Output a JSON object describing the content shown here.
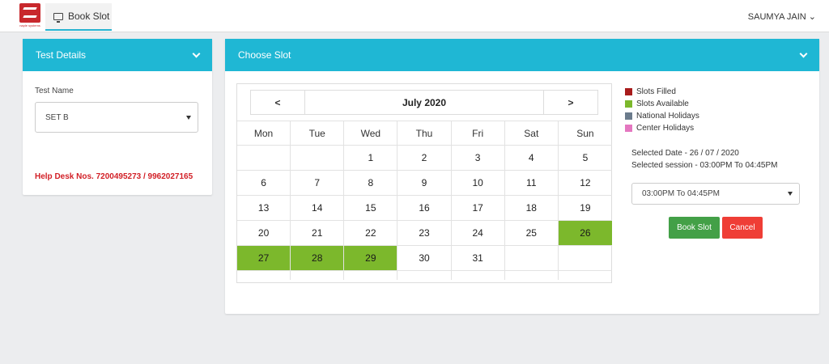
{
  "header": {
    "logo_caption": "naple systems",
    "tab_label": "Book Slot",
    "user_name": "SAUMYA JAIN ⌄"
  },
  "test_details": {
    "title": "Test Details",
    "test_name_label": "Test Name",
    "test_name_value": "SET B",
    "help_desk": "Help Desk Nos. 7200495273 / 9962027165"
  },
  "choose_slot": {
    "title": "Choose Slot",
    "prev": "<",
    "next": ">",
    "month_label": "July 2020",
    "weekdays": [
      "Mon",
      "Tue",
      "Wed",
      "Thu",
      "Fri",
      "Sat",
      "Sun"
    ],
    "weeks": [
      [
        "",
        "",
        "1",
        "2",
        "3",
        "4",
        "5"
      ],
      [
        "6",
        "7",
        "8",
        "9",
        "10",
        "11",
        "12"
      ],
      [
        "13",
        "14",
        "15",
        "16",
        "17",
        "18",
        "19"
      ],
      [
        "20",
        "21",
        "22",
        "23",
        "24",
        "25",
        "26"
      ],
      [
        "27",
        "28",
        "29",
        "30",
        "31",
        "",
        ""
      ]
    ],
    "available_days": [
      "26",
      "27",
      "28",
      "29"
    ],
    "legend": [
      {
        "label": "Slots Filled",
        "color": "#a81c1c"
      },
      {
        "label": "Slots Available",
        "color": "#7cb82c"
      },
      {
        "label": "National Holidays",
        "color": "#6b7b8c"
      },
      {
        "label": "Center Holidays",
        "color": "#e477c0"
      }
    ],
    "selected_date": "Selected Date - 26 / 07 / 2020",
    "selected_session": "Selected session - 03:00PM To 04:45PM",
    "session_value": "03:00PM To 04:45PM",
    "book_button": "Book Slot",
    "cancel_button": "Cancel"
  },
  "colors": {
    "header_accent": "#1fb7d4",
    "available": "#7cb82c",
    "book_button": "#43a047",
    "cancel_button": "#ef3e36",
    "help_text": "#d21f26"
  }
}
